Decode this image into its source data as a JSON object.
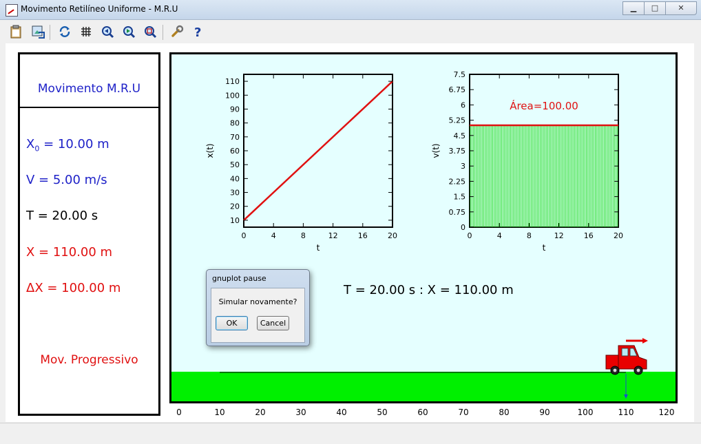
{
  "window": {
    "title": "Movimento Retilíneo Uniforme - M.R.U",
    "minimize_glyph": "▁",
    "maximize_glyph": "□",
    "close_glyph": "✕"
  },
  "toolbar": {
    "icons": [
      "clipboard-icon",
      "export-image-icon",
      "replot-icon",
      "grid-icon",
      "zoom-previous-icon",
      "zoom-next-icon",
      "zoom-autoscale-icon",
      "options-wrench-icon",
      "help-icon"
    ]
  },
  "panel": {
    "title": "Movimento M.R.U",
    "x0_label": "X",
    "x0_sub": "0",
    "x0_value": " = 10.00 m",
    "v": "V = 5.00 m/s",
    "t": "T = 20.00 s",
    "x": "X = 110.00 m",
    "dx": "ΔX = 100.00 m",
    "direction": "Mov. Progressivo"
  },
  "scene": {
    "result": "T = 20.00 s : X = 110.00 m",
    "ground_color": "#00f000",
    "background_color": "#e5ffff",
    "car_color": "#e80000",
    "car_position": 110,
    "position_axis_ticks": [
      "0",
      "10",
      "20",
      "30",
      "40",
      "50",
      "60",
      "70",
      "80",
      "90",
      "100",
      "110",
      "120"
    ]
  },
  "dialog": {
    "title": "gnuplot pause",
    "message": "Simular novamente?",
    "ok": "OK",
    "cancel": "Cancel"
  },
  "chart_data": [
    {
      "type": "line",
      "xlabel": "t",
      "ylabel": "x(t)",
      "xlim": [
        0,
        20
      ],
      "ylim": [
        5,
        115
      ],
      "x_ticks": [
        "0",
        "4",
        "8",
        "12",
        "16",
        "20"
      ],
      "y_ticks": [
        "10",
        "20",
        "30",
        "40",
        "50",
        "60",
        "70",
        "80",
        "90",
        "100",
        "110"
      ],
      "x": [
        0,
        20
      ],
      "y": [
        10,
        110
      ],
      "line_color": "#e01010"
    },
    {
      "type": "area",
      "xlabel": "t",
      "ylabel": "v(t)",
      "xlim": [
        0,
        20
      ],
      "ylim": [
        0,
        7.5
      ],
      "x_ticks": [
        "0",
        "4",
        "8",
        "12",
        "16",
        "20"
      ],
      "y_ticks": [
        "0",
        "0.75",
        "1.5",
        "2.25",
        "3",
        "3.75",
        "4.5",
        "5.25",
        "6",
        "6.75",
        "7.5"
      ],
      "x": [
        0,
        20
      ],
      "y": [
        5,
        5
      ],
      "annotation": "Área=100.00",
      "line_color": "#e01010",
      "fill_color": "#22dd22"
    }
  ]
}
